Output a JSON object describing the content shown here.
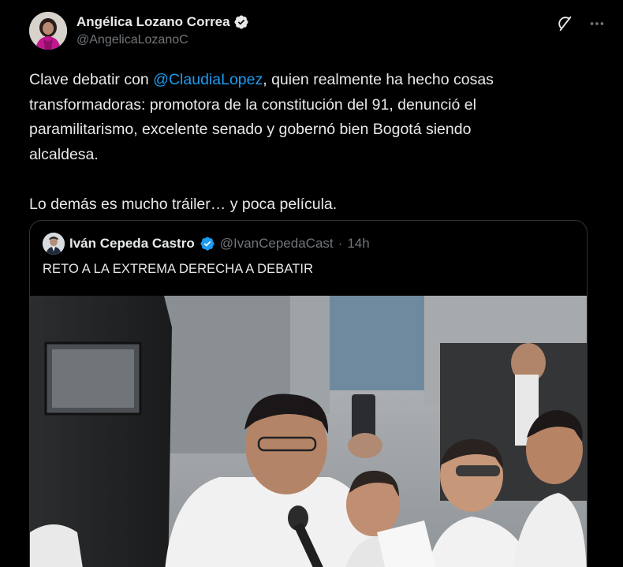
{
  "author": {
    "display_name": "Angélica Lozano Correa",
    "handle": "@AngelicaLozanoC",
    "verified": true
  },
  "header_actions": {
    "grok_icon": "grok-icon",
    "more_icon": "more-icon"
  },
  "tweet": {
    "line1_before": "Clave debatir con ",
    "mention": "@ClaudiaLopez",
    "line1_after": ", quien realmente ha hecho cosas",
    "line2": "transformadoras: promotora de la constitución del 91, denunció el",
    "line3": "paramilitarismo, excelente senado y gobernó bien Bogotá siendo",
    "line4": "alcaldesa.",
    "line5": "Lo demás es mucho tráiler… y poca película."
  },
  "quote": {
    "display_name": "Iván Cepeda Castro",
    "handle": "@IvanCepedaCast",
    "separator": "·",
    "time": "14h",
    "text": "RETO A LA EXTREMA DERECHA A DEBATIR",
    "verified": true
  },
  "colors": {
    "background": "#000000",
    "text": "#e7e9ea",
    "secondary": "#71767b",
    "link": "#1d9bf0",
    "border": "#2f3336"
  }
}
